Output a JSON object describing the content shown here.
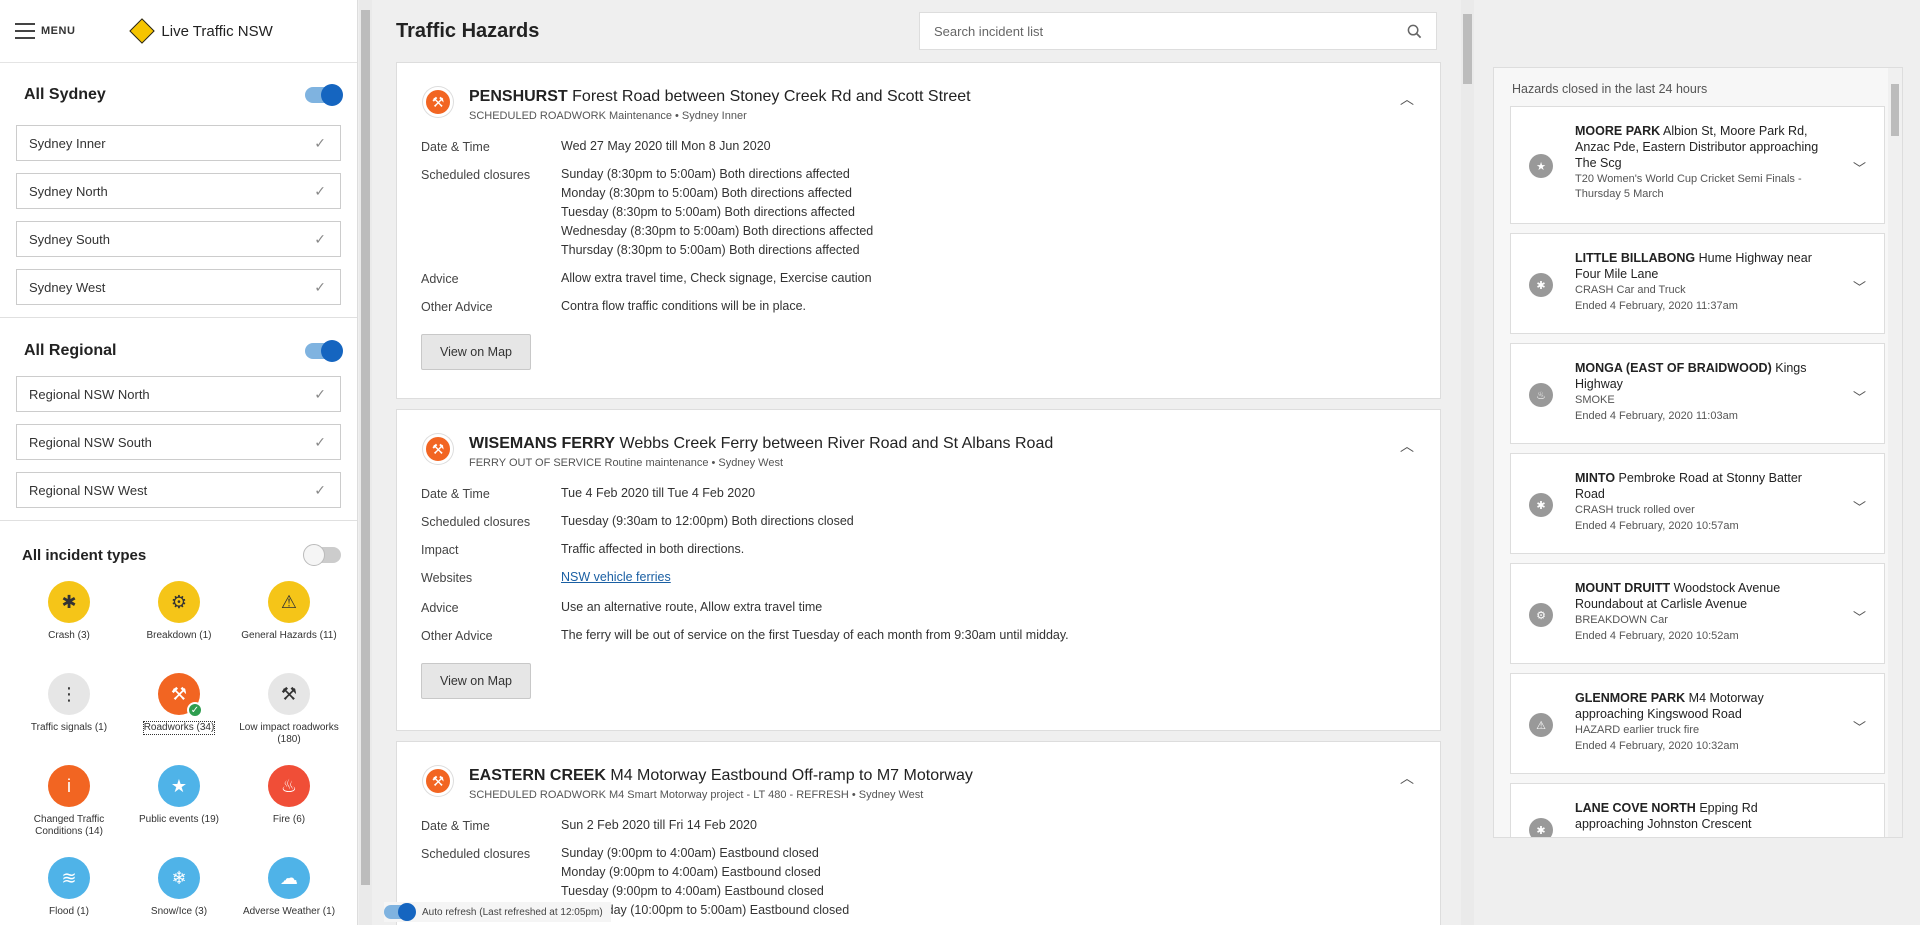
{
  "sidebar": {
    "menu_label": "MENU",
    "brand": "Live Traffic NSW",
    "sydney": {
      "title": "All Sydney",
      "items": [
        "Sydney Inner",
        "Sydney North",
        "Sydney South",
        "Sydney West"
      ]
    },
    "regional": {
      "title": "All Regional",
      "items": [
        "Regional NSW North",
        "Regional NSW South",
        "Regional NSW West"
      ]
    },
    "incident_types": {
      "title": "All incident types",
      "items": [
        {
          "label": "Crash  (3)",
          "icon": "crash-icon",
          "color": "#f5c518",
          "glyph": "✱"
        },
        {
          "label": "Breakdown (1)",
          "icon": "breakdown-icon",
          "color": "#f5c518",
          "glyph": "⚙"
        },
        {
          "label": "General Hazards  (11)",
          "icon": "hazard-icon",
          "color": "#f5c518",
          "glyph": "⚠"
        },
        {
          "label": "Traffic signals  (1)",
          "icon": "traffic-signal-icon",
          "color": "#e6e6e6",
          "glyph": "⋮"
        },
        {
          "label": "Roadworks  (34)",
          "icon": "roadworks-icon",
          "color": "#f26522",
          "glyph": "⚒"
        },
        {
          "label": "Low impact roadworks (180)",
          "icon": "low-impact-roadworks-icon",
          "color": "#e6e6e6",
          "glyph": "⚒"
        },
        {
          "label": "Changed Traffic Conditions  (14)",
          "icon": "info-icon",
          "color": "#f26522",
          "glyph": "i"
        },
        {
          "label": "Public events  (19)",
          "icon": "star-icon",
          "color": "#4fb3e8",
          "glyph": "★"
        },
        {
          "label": "Fire  (6)",
          "icon": "fire-icon",
          "color": "#f04e37",
          "glyph": "♨"
        },
        {
          "label": "Flood  (1)",
          "icon": "flood-icon",
          "color": "#4fb3e8",
          "glyph": "≋"
        },
        {
          "label": "Snow/Ice  (3)",
          "icon": "snowflake-icon",
          "color": "#4fb3e8",
          "glyph": "❄"
        },
        {
          "label": "Adverse Weather  (1)",
          "icon": "weather-icon",
          "color": "#4fb3e8",
          "glyph": "☁"
        }
      ]
    }
  },
  "main": {
    "title": "Traffic Hazards",
    "search_placeholder": "Search incident list",
    "view_on_map": "View on Map",
    "cards": [
      {
        "suburb": "PENSHURST",
        "road": "Forest Road between Stoney Creek Rd and Scott Street",
        "subtitle": "SCHEDULED ROADWORK Maintenance • Sydney Inner",
        "rows": [
          {
            "label": "Date & Time",
            "value": "Wed 27 May 2020 till Mon 8 Jun 2020"
          },
          {
            "label": "Scheduled closures",
            "lines": [
              "Sunday (8:30pm to 5:00am) Both directions affected",
              "Monday (8:30pm to 5:00am) Both directions affected",
              "Tuesday (8:30pm to 5:00am) Both directions affected",
              "Wednesday (8:30pm to 5:00am) Both directions affected",
              "Thursday (8:30pm to 5:00am) Both directions affected"
            ]
          },
          {
            "label": "Advice",
            "value": "Allow extra travel time, Check signage, Exercise caution"
          },
          {
            "label": "Other Advice",
            "value": "Contra flow traffic conditions will be in place."
          }
        ]
      },
      {
        "suburb": "WISEMANS FERRY",
        "road": "Webbs Creek Ferry between River Road and St Albans Road",
        "subtitle": "FERRY OUT OF SERVICE Routine maintenance • Sydney West",
        "rows": [
          {
            "label": "Date & Time",
            "value": "Tue 4 Feb 2020 till Tue 4 Feb 2020"
          },
          {
            "label": "Scheduled closures",
            "value": "Tuesday (9:30am to 12:00pm) Both directions closed"
          },
          {
            "label": "Impact",
            "value": "Traffic affected in both directions."
          },
          {
            "label": "Websites",
            "link": "NSW vehicle ferries"
          },
          {
            "label": "Advice",
            "value": "Use an alternative route, Allow extra travel time"
          },
          {
            "label": "Other Advice",
            "value": "The ferry will be out of service on the first Tuesday of each month from 9:30am until midday."
          }
        ]
      },
      {
        "suburb": "EASTERN CREEK",
        "road": "M4 Motorway Eastbound Off-ramp to M7 Motorway",
        "subtitle": "SCHEDULED ROADWORK M4 Smart Motorway project - LT 480 - REFRESH • Sydney West",
        "rows": [
          {
            "label": "Date & Time",
            "value": "Sun 2 Feb 2020 till Fri 14 Feb 2020"
          },
          {
            "label": "Scheduled closures",
            "lines": [
              "Sunday (9:00pm to 4:00am) Eastbound closed",
              "Monday (9:00pm to 4:00am) Eastbound closed",
              "Tuesday (9:00pm to 4:00am) Eastbound closed",
              "Wednesday (10:00pm to 5:00am) Eastbound closed"
            ]
          }
        ]
      }
    ],
    "auto_refresh": "Auto refresh (Last refreshed at 12:05pm)"
  },
  "right_panel": {
    "title": "Hazards closed in the last 24 hours",
    "items": [
      {
        "suburb": "MOORE PARK",
        "road": "Albion St, Moore Park Rd, Anzac Pde, Eastern Distributor approaching The Scg",
        "sub1": "T20 Women's World Cup Cricket Semi Finals - Thursday 5 March",
        "sub2": "",
        "icon": "star-icon",
        "glyph": "★"
      },
      {
        "suburb": "LITTLE BILLABONG",
        "road": "Hume Highway near Four Mile Lane",
        "sub1": "CRASH Car and Truck",
        "sub2": "Ended 4 February, 2020 11:37am",
        "icon": "crash-icon",
        "glyph": "✱"
      },
      {
        "suburb": "MONGA (EAST OF BRAIDWOOD)",
        "road": "Kings Highway",
        "sub1": "SMOKE",
        "sub2": "Ended 4 February, 2020 11:03am",
        "icon": "fire-icon",
        "glyph": "♨"
      },
      {
        "suburb": "MINTO",
        "road": "Pembroke Road at Stonny Batter Road",
        "sub1": "CRASH truck rolled over",
        "sub2": "Ended 4 February, 2020 10:57am",
        "icon": "crash-icon",
        "glyph": "✱"
      },
      {
        "suburb": "MOUNT DRUITT",
        "road": "Woodstock Avenue Roundabout at Carlisle Avenue",
        "sub1": "BREAKDOWN Car",
        "sub2": "Ended 4 February, 2020 10:52am",
        "icon": "breakdown-icon",
        "glyph": "⚙"
      },
      {
        "suburb": "GLENMORE PARK",
        "road": "M4 Motorway approaching Kingswood Road",
        "sub1": "HAZARD earlier truck fire",
        "sub2": "Ended 4 February, 2020 10:32am",
        "icon": "hazard-icon",
        "glyph": "⚠"
      },
      {
        "suburb": "LANE COVE NORTH",
        "road": "Epping Rd approaching Johnston Crescent",
        "sub1": "",
        "sub2": "",
        "icon": "crash-icon",
        "glyph": "✱"
      }
    ]
  }
}
